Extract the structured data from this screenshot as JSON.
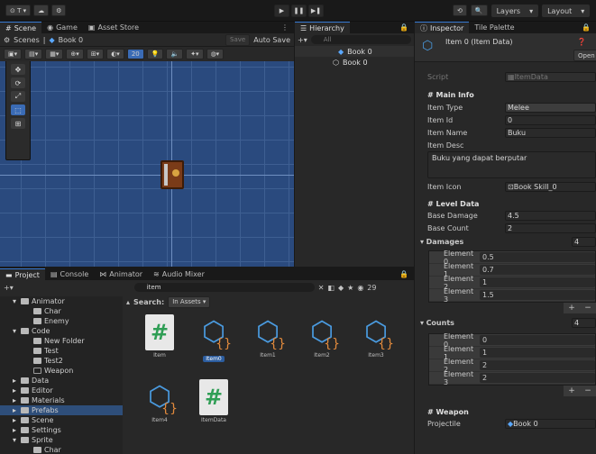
{
  "toolbar": {
    "account_label": "⊙ T ▾",
    "play_icons": [
      "▶",
      "❚❚",
      "▶❚"
    ],
    "layers": "Layers",
    "layout": "Layout"
  },
  "scene_panel": {
    "tabs": [
      "Scene",
      "Game",
      "Asset Store"
    ],
    "breadcrumb_scenes": "Scenes",
    "breadcrumb_item": "Book 0",
    "save": "Save",
    "auto_save": "Auto Save",
    "zoom_value": "20"
  },
  "hierarchy": {
    "tab": "Hierarchy",
    "search_placeholder": "All",
    "items": [
      "Book 0",
      "Book 0"
    ]
  },
  "project": {
    "tabs": [
      "Project",
      "Console",
      "Animator",
      "Audio Mixer"
    ],
    "search_value": "item",
    "search_scope": "Search:",
    "search_scope_value": "In Assets ▾",
    "count": "29",
    "tree": [
      {
        "label": "Animator",
        "depth": 0,
        "expanded": true,
        "empty": false
      },
      {
        "label": "Char",
        "depth": 1,
        "expanded": false,
        "empty": false
      },
      {
        "label": "Enemy",
        "depth": 1,
        "expanded": false,
        "empty": false
      },
      {
        "label": "Code",
        "depth": 0,
        "expanded": true,
        "empty": false
      },
      {
        "label": "New Folder",
        "depth": 1,
        "expanded": false,
        "empty": false
      },
      {
        "label": "Test",
        "depth": 1,
        "expanded": false,
        "empty": false
      },
      {
        "label": "Test2",
        "depth": 1,
        "expanded": false,
        "empty": false
      },
      {
        "label": "Weapon",
        "depth": 1,
        "expanded": false,
        "empty": true
      },
      {
        "label": "Data",
        "depth": 0,
        "expanded": false,
        "empty": false
      },
      {
        "label": "Editor",
        "depth": 0,
        "expanded": false,
        "empty": false
      },
      {
        "label": "Materials",
        "depth": 0,
        "expanded": false,
        "empty": false
      },
      {
        "label": "Prefabs",
        "depth": 0,
        "expanded": false,
        "empty": false
      },
      {
        "label": "Scene",
        "depth": 0,
        "expanded": false,
        "empty": false
      },
      {
        "label": "Settings",
        "depth": 0,
        "expanded": false,
        "empty": false
      },
      {
        "label": "Sprite",
        "depth": 0,
        "expanded": true,
        "empty": false
      },
      {
        "label": "Char",
        "depth": 1,
        "expanded": false,
        "empty": false
      }
    ],
    "assets": [
      {
        "label": "Item",
        "type": "script"
      },
      {
        "label": "Item0",
        "type": "so"
      },
      {
        "label": "Item1",
        "type": "so"
      },
      {
        "label": "Item2",
        "type": "so"
      },
      {
        "label": "Item3",
        "type": "so"
      },
      {
        "label": "Item4",
        "type": "so"
      },
      {
        "label": "ItemData",
        "type": "script"
      }
    ]
  },
  "inspector": {
    "tabs": [
      "Inspector",
      "Tile Palette"
    ],
    "title": "Item 0 (Item Data)",
    "open": "Open",
    "script_label": "Script",
    "script_value": "ItemData",
    "main_info_header": "# Main Info",
    "item_type_label": "Item Type",
    "item_type_value": "Melee",
    "item_id_label": "Item Id",
    "item_id_value": "0",
    "item_name_label": "Item Name",
    "item_name_value": "Buku",
    "item_desc_label": "Item Desc",
    "item_desc_value": "Buku yang dapat berputar",
    "item_icon_label": "Item Icon",
    "item_icon_value": "Book Skill_0",
    "level_header": "# Level Data",
    "base_damage_label": "Base Damage",
    "base_damage_value": "4.5",
    "base_count_label": "Base Count",
    "base_count_value": "2",
    "damages_label": "Damages",
    "damages_size": "4",
    "damages": [
      {
        "label": "Element 0",
        "value": "0.5"
      },
      {
        "label": "Element 1",
        "value": "0.7"
      },
      {
        "label": "Element 2",
        "value": "1"
      },
      {
        "label": "Element 3",
        "value": "1.5"
      }
    ],
    "counts_label": "Counts",
    "counts_size": "4",
    "counts": [
      {
        "label": "Element 0",
        "value": "0"
      },
      {
        "label": "Element 1",
        "value": "1"
      },
      {
        "label": "Element 2",
        "value": "2"
      },
      {
        "label": "Element 3",
        "value": "2"
      }
    ],
    "weapon_header": "# Weapon",
    "projectile_label": "Projectile",
    "projectile_value": "Book 0",
    "plus_minus": "+ −"
  },
  "colors": {
    "accent": "#3a7bd5",
    "scene_bg": "#2a4a7e",
    "selection": "#2e4e7a",
    "script_icon": "#2f9e55",
    "so_icon": "#4a9be0",
    "so_brace": "#e28a3c"
  }
}
